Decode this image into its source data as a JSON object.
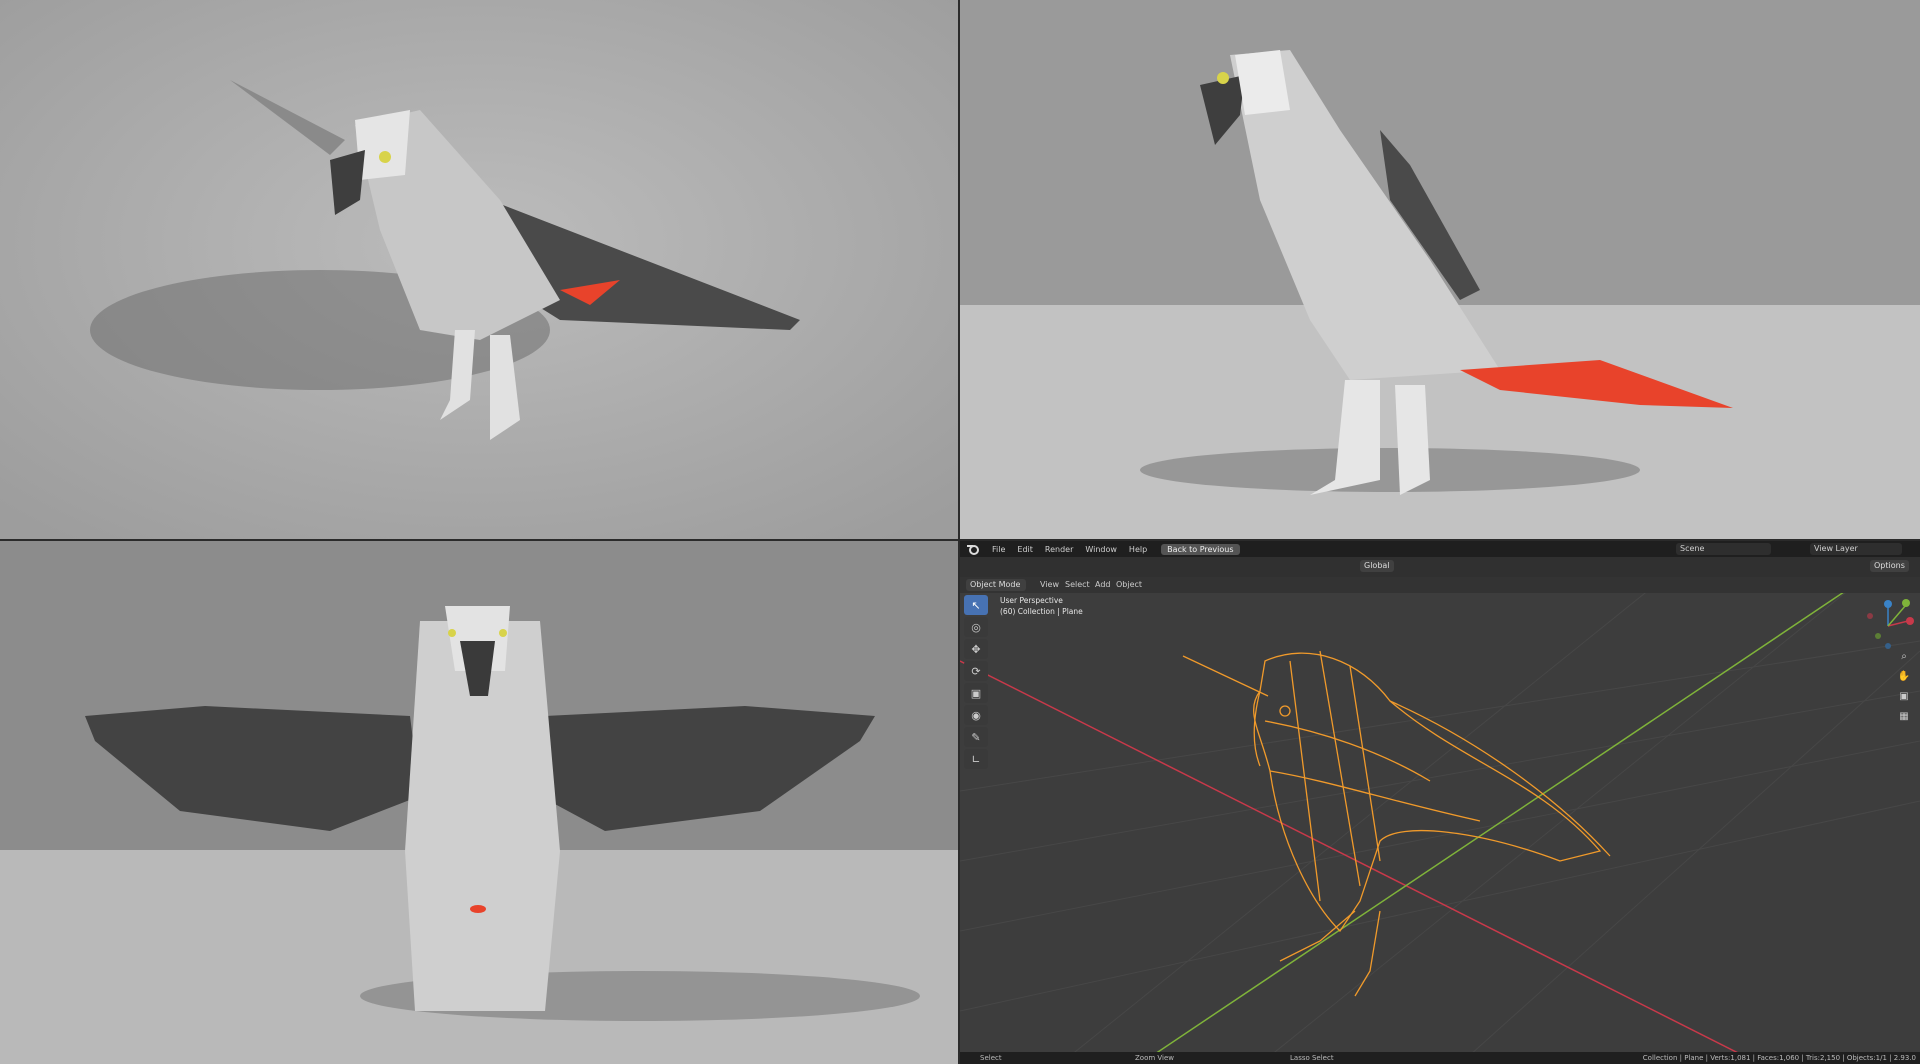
{
  "blender": {
    "menu": [
      "File",
      "Edit",
      "Render",
      "Window",
      "Help"
    ],
    "back_button": "Back to Previous",
    "scene": "Scene",
    "view_layer": "View Layer",
    "header": {
      "mode": "Object Mode",
      "view": "View",
      "select": "Select",
      "add": "Add",
      "object": "Object",
      "transform_orientation": "Global",
      "options": "Options"
    },
    "viewport": {
      "perspective": "User Perspective",
      "collection": "(60) Collection | Plane"
    },
    "status": {
      "left": "Select",
      "middle": "Zoom View",
      "right": "Lasso Select",
      "stats": "Collection | Plane | Verts:1,081 | Faces:1,060 | Tris:2,150 | Objects:1/1 | 2.93.0"
    },
    "colors": {
      "accent": "#4772b3",
      "wireframe": "#f09a2b",
      "axis_x": "#c8394a",
      "axis_y": "#7fb33a",
      "axis_z": "#3a83c8",
      "tail": "#e8432b"
    }
  },
  "icons": [
    "blender-logo-icon",
    "select-box-icon",
    "cursor-icon",
    "move-icon",
    "rotate-icon",
    "scale-icon",
    "transform-icon",
    "annotate-icon",
    "measure-icon",
    "zoom-icon",
    "hand-icon",
    "camera-icon",
    "grid-icon"
  ]
}
